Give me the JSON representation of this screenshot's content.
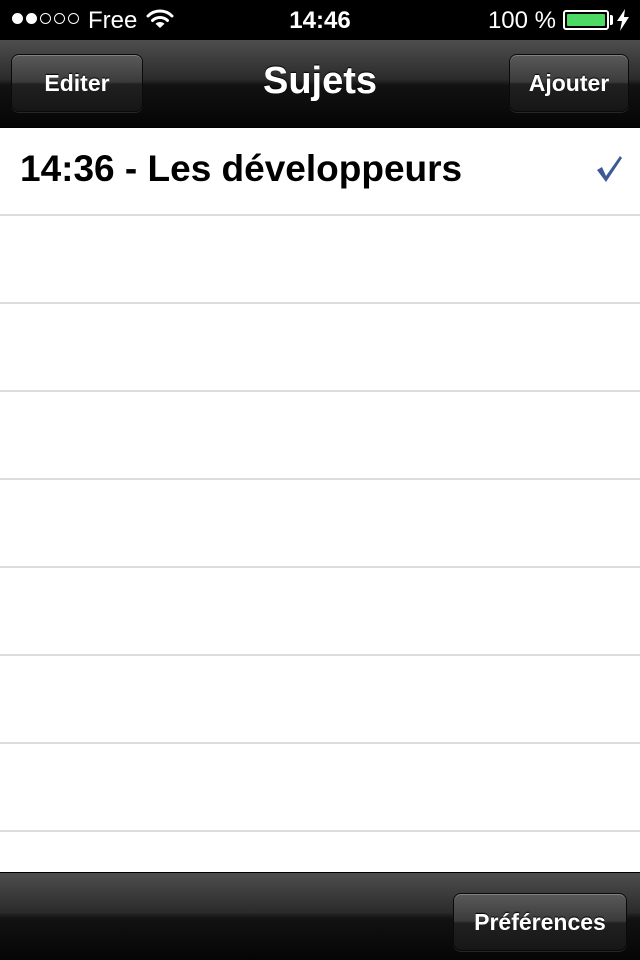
{
  "status_bar": {
    "signal_bars_filled": 2,
    "signal_bars_total": 5,
    "carrier": "Free",
    "time": "14:46",
    "battery_percent": "100 %",
    "battery_level": 1.0,
    "battery_color": "#4cd964",
    "wifi_icon": "wifi-icon",
    "charging_icon": "bolt-icon"
  },
  "nav_bar": {
    "title": "Sujets",
    "left_button": "Editer",
    "right_button": "Ajouter"
  },
  "list": {
    "items": [
      {
        "label": "14:36 - Les développeurs",
        "checked": true,
        "accessory_icon": "checkmark-icon"
      }
    ],
    "checkmark_color": "#3d5a96"
  },
  "toolbar": {
    "preferences_button": "Préférences"
  }
}
